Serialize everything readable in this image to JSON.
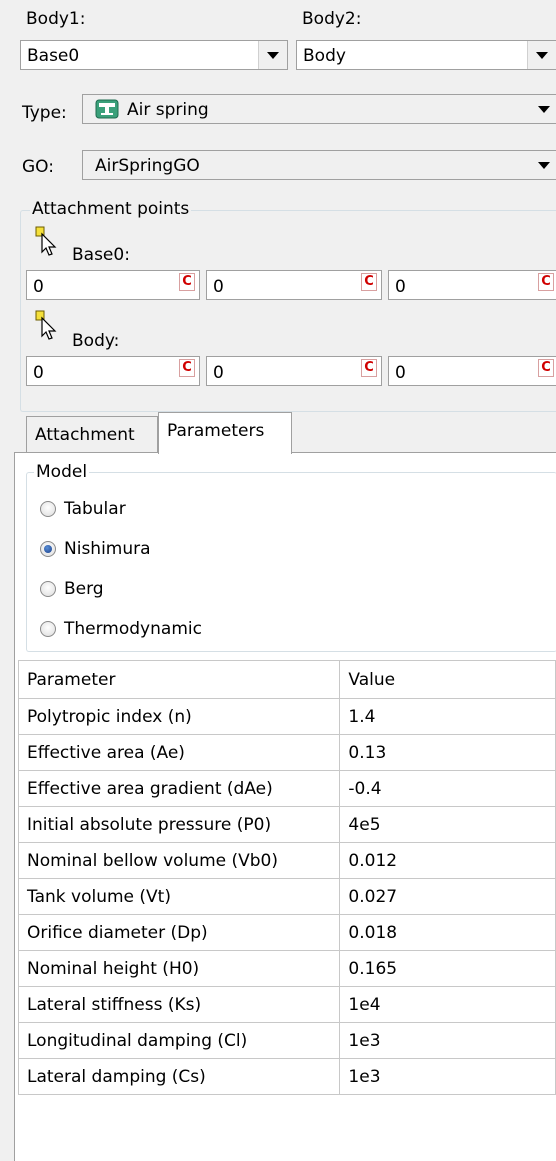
{
  "body1": {
    "label": "Body1:",
    "value": "Base0"
  },
  "body2": {
    "label": "Body2:",
    "value": "Body"
  },
  "type": {
    "label": "Type:",
    "value": "Air spring",
    "icon": "air-spring-icon"
  },
  "go": {
    "label": "GO:",
    "value": "AirSpringGO"
  },
  "attachment_points": {
    "title": "Attachment points",
    "base0": {
      "label": "Base0:",
      "values": [
        "0",
        "0",
        "0"
      ]
    },
    "body": {
      "label": "Body:",
      "values": [
        "0",
        "0",
        "0"
      ]
    },
    "c_label": "C"
  },
  "tabs": [
    {
      "label": "Attachment",
      "active": false
    },
    {
      "label": "Parameters",
      "active": true
    }
  ],
  "model": {
    "title": "Model",
    "options": [
      {
        "label": "Tabular",
        "selected": false
      },
      {
        "label": "Nishimura",
        "selected": true
      },
      {
        "label": "Berg",
        "selected": false
      },
      {
        "label": "Thermodynamic",
        "selected": false
      }
    ]
  },
  "table": {
    "headers": [
      "Parameter",
      "Value"
    ],
    "rows": [
      [
        "Polytropic index (n)",
        "1.4"
      ],
      [
        "Effective area (Ae)",
        "0.13"
      ],
      [
        "Effective area gradient (dAe)",
        "-0.4"
      ],
      [
        "Initial absolute pressure (P0)",
        "4e5"
      ],
      [
        "Nominal bellow volume (Vb0)",
        "0.012"
      ],
      [
        "Tank volume (Vt)",
        "0.027"
      ],
      [
        "Orifice diameter (Dp)",
        "0.018"
      ],
      [
        "Nominal height (H0)",
        "0.165"
      ],
      [
        "Lateral stiffness (Ks)",
        "1e4"
      ],
      [
        "Longitudinal damping (Cl)",
        "1e3"
      ],
      [
        "Lateral damping (Cs)",
        "1e3"
      ]
    ]
  }
}
